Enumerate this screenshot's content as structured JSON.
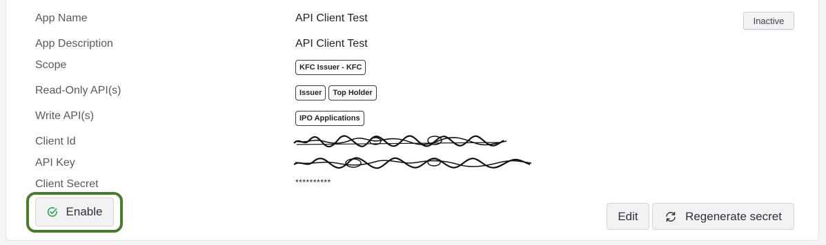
{
  "fields": {
    "app_name_label": "App Name",
    "app_name_value": "API Client Test",
    "app_description_label": "App Description",
    "app_description_value": "API Client Test",
    "scope_label": "Scope",
    "scope_tags": [
      "KFC Issuer - KFC"
    ],
    "read_only_label": "Read-Only API(s)",
    "read_only_tags": [
      "Issuer",
      "Top Holder"
    ],
    "write_label": "Write API(s)",
    "write_tags": [
      "IPO Applications"
    ],
    "client_id_label": "Client Id",
    "api_key_label": "API Key",
    "client_secret_label": "Client Secret",
    "client_secret_value": "**********"
  },
  "status": {
    "label": "Inactive"
  },
  "actions": {
    "enable_label": "Enable",
    "edit_label": "Edit",
    "regenerate_label": "Regenerate secret"
  },
  "icons": {
    "enable": "check-circle-icon",
    "regenerate": "refresh-icon"
  },
  "colors": {
    "highlight": "#4a7a2c",
    "enable_icon": "#2e9e57"
  }
}
